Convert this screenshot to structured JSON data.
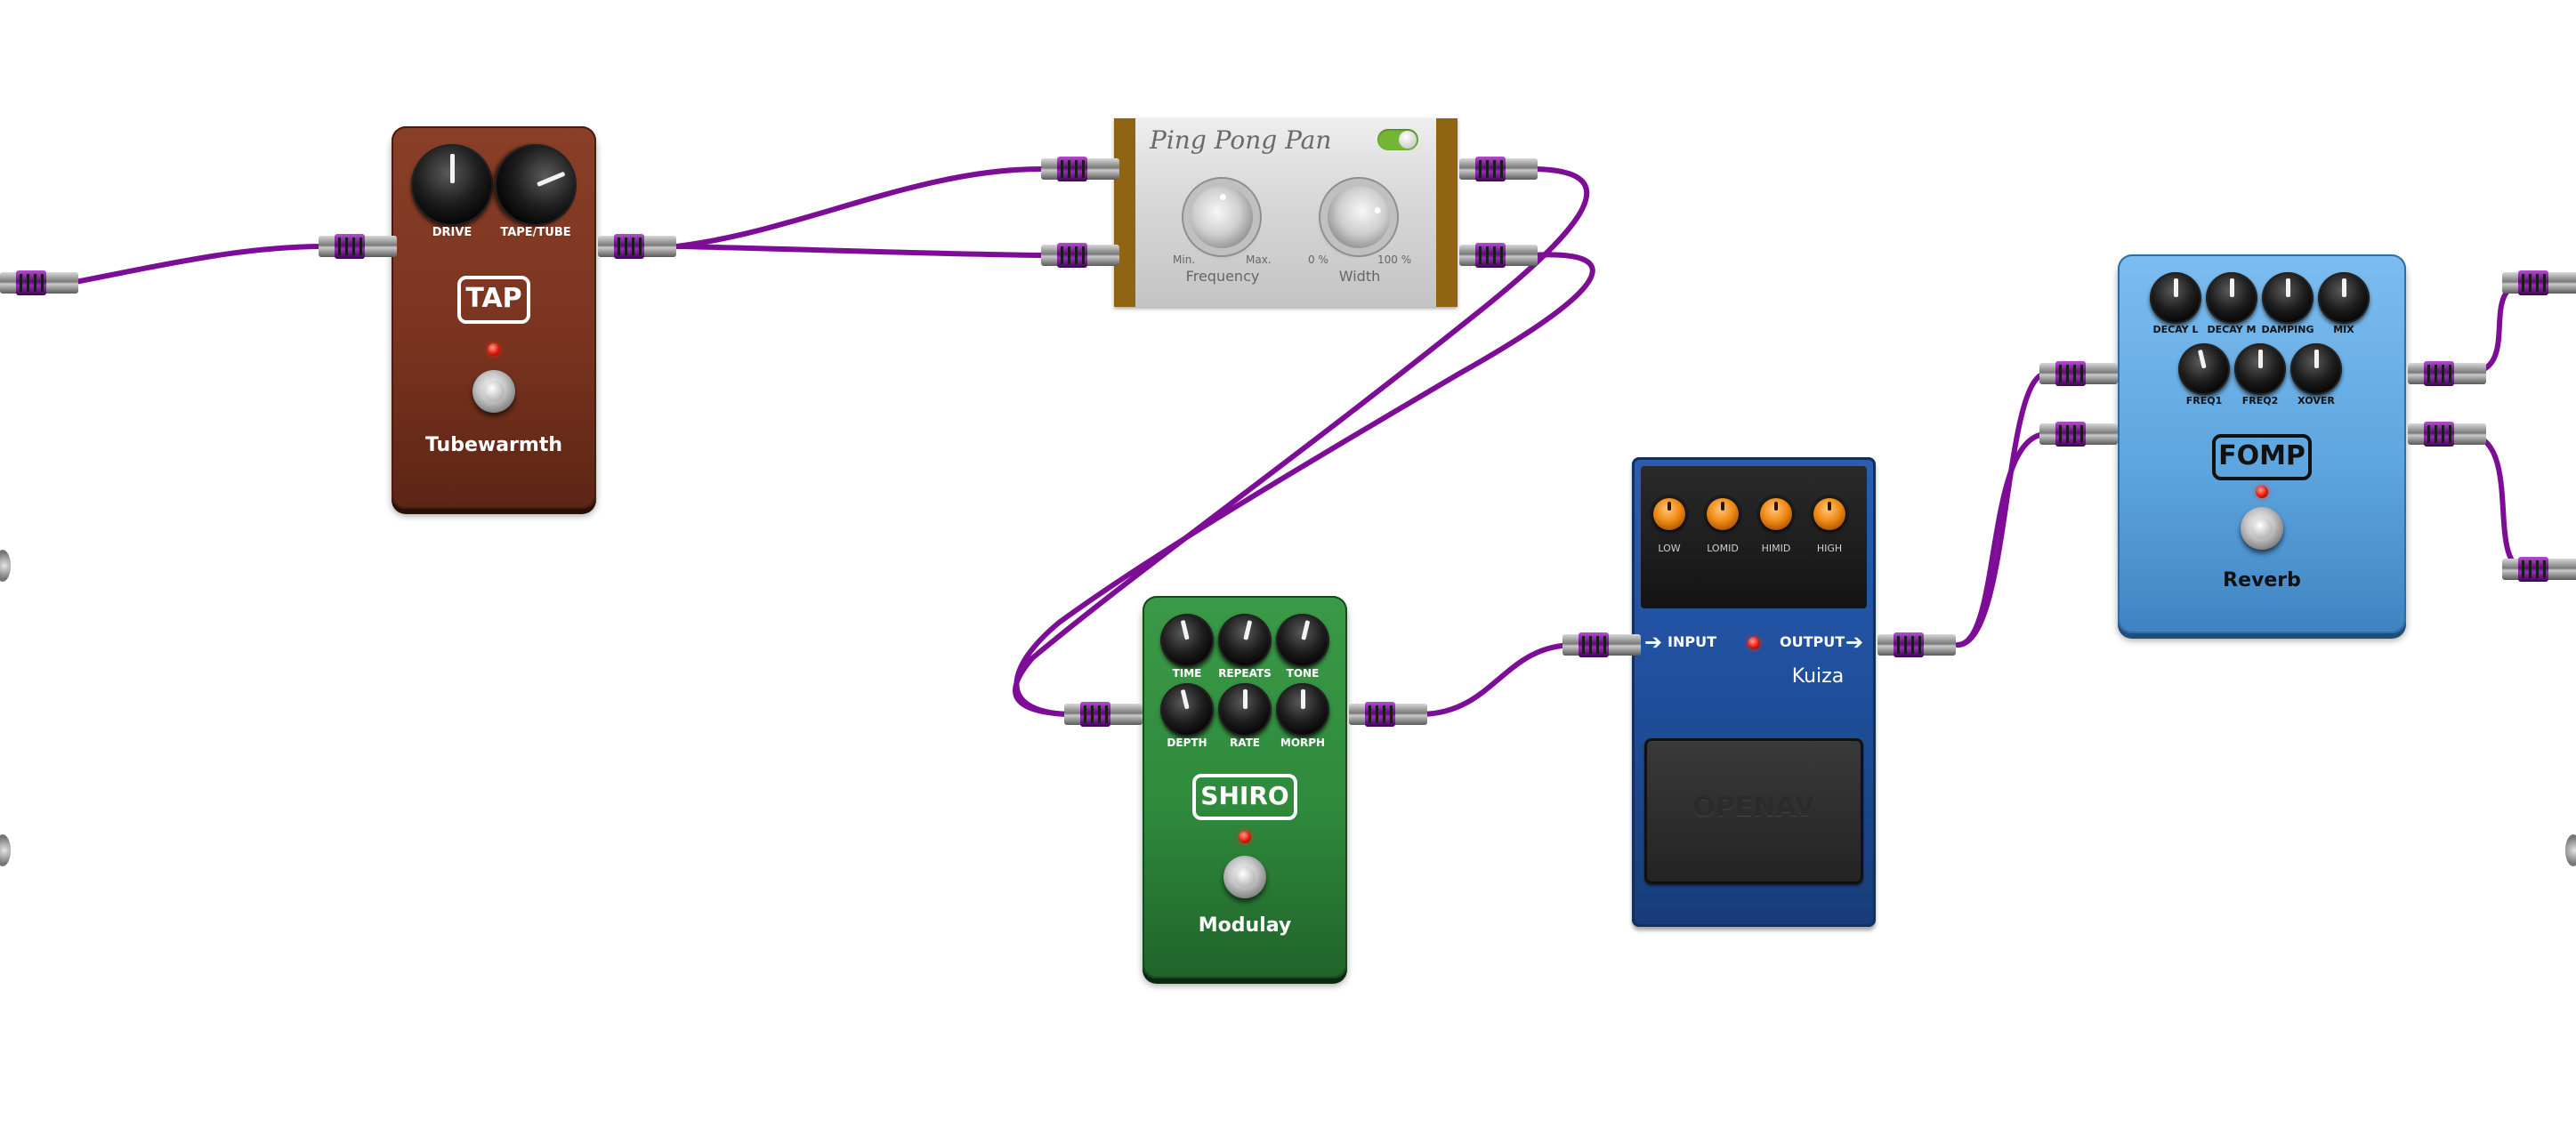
{
  "pedals": {
    "tubewarmth": {
      "brand": "TAP",
      "name": "Tubewarmth",
      "knobs": [
        {
          "label": "DRIVE",
          "value": 0.5
        },
        {
          "label": "TAPE/TUBE",
          "value": 0.75
        }
      ],
      "color": "#7a3420",
      "led_on": true
    },
    "pingpongpan": {
      "title": "Ping Pong Pan",
      "enabled": true,
      "frequency": {
        "label": "Frequency",
        "min_label": "Min.",
        "max_label": "Max.",
        "value": 0.45
      },
      "width": {
        "label": "Width",
        "min_label": "0 %",
        "max_label": "100 %",
        "value": 0.7
      }
    },
    "modulay": {
      "brand": "SHIRO",
      "name": "Modulay",
      "knobs": [
        {
          "label": "TIME",
          "value": 0.45
        },
        {
          "label": "REPEATS",
          "value": 0.55
        },
        {
          "label": "TONE",
          "value": 0.55
        },
        {
          "label": "DEPTH",
          "value": 0.45
        },
        {
          "label": "RATE",
          "value": 0.5
        },
        {
          "label": "MORPH",
          "value": 0.5
        }
      ],
      "color": "#2f8a3c",
      "led_on": true
    },
    "kuiza": {
      "name": "Kuiza",
      "input_label": "INPUT",
      "output_label": "OUTPUT",
      "footplate_text": "OPENAV",
      "knobs": [
        {
          "label": "LOW",
          "value": 0.5
        },
        {
          "label": "LOMID",
          "value": 0.5
        },
        {
          "label": "HIMID",
          "value": 0.5
        },
        {
          "label": "HIGH",
          "value": 0.5
        }
      ],
      "color": "#1f4f9c",
      "led_on": true
    },
    "reverb": {
      "brand": "FOMP",
      "name": "Reverb",
      "knobs": [
        {
          "label": "DECAY L",
          "value": 0.5
        },
        {
          "label": "DECAY M",
          "value": 0.5
        },
        {
          "label": "DAMPING",
          "value": 0.5
        },
        {
          "label": "MIX",
          "value": 0.5
        },
        {
          "label": "FREQ1",
          "value": 0.45
        },
        {
          "label": "FREQ2",
          "value": 0.5
        },
        {
          "label": "XOVER",
          "value": 0.5
        }
      ],
      "color": "#5ea6e0",
      "led_on": true
    }
  },
  "colors": {
    "cable": "#7d0d96",
    "background": "#ffffff"
  }
}
